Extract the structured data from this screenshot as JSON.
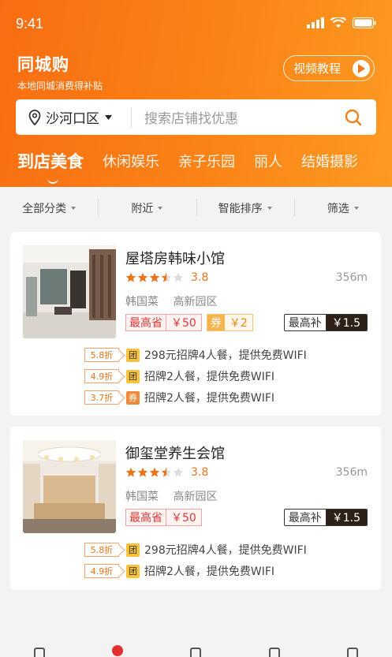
{
  "status_bar": {
    "time": "9:41"
  },
  "brand": {
    "title": "同城购",
    "subtitle": "本地同城消费得补贴"
  },
  "video_tutorial": {
    "label": "视频教程"
  },
  "search": {
    "location": "沙河口区",
    "placeholder": "搜索店铺找优惠"
  },
  "category_tabs": [
    {
      "label": "到店美食",
      "active": true
    },
    {
      "label": "休闲娱乐"
    },
    {
      "label": "亲子乐园"
    },
    {
      "label": "丽人"
    },
    {
      "label": "结婚摄影"
    }
  ],
  "filters": [
    {
      "label": "全部分类"
    },
    {
      "label": "附近"
    },
    {
      "label": "智能排序"
    },
    {
      "label": "筛选"
    }
  ],
  "shops": [
    {
      "name": "屋塔房韩味小馆",
      "rating": "3.8",
      "stars": 3.5,
      "distance": "356m",
      "tags": [
        "韩国菜",
        "高新园区"
      ],
      "badges": [
        {
          "label": "最高省",
          "value": "￥50",
          "kind": "save"
        },
        {
          "label": "券",
          "value": "￥2",
          "kind": "coupon"
        }
      ],
      "subsidy": {
        "label": "最高补",
        "value": "￥1.5"
      },
      "deals": [
        {
          "discount": "5.8折",
          "type": "团",
          "text": "298元招牌4人餐，提供免费WIFI"
        },
        {
          "discount": "4.9折",
          "type": "团",
          "text": "招牌2人餐，提供免费WIFI"
        },
        {
          "discount": "3.7折",
          "type": "券",
          "text": "招牌2人餐，提供免费WIFI"
        }
      ]
    },
    {
      "name": "御玺堂养生会馆",
      "rating": "3.8",
      "stars": 3.5,
      "distance": "356m",
      "tags": [
        "韩国菜",
        "高新园区"
      ],
      "badges": [
        {
          "label": "最高省",
          "value": "￥50",
          "kind": "save"
        }
      ],
      "subsidy": {
        "label": "最高补",
        "value": "￥1.5"
      },
      "deals": [
        {
          "discount": "5.8折",
          "type": "团",
          "text": "298元招牌4人餐，提供免费WIFI"
        },
        {
          "discount": "4.9折",
          "type": "团",
          "text": "招牌2人餐，提供免费WIFI"
        }
      ]
    }
  ],
  "colors": {
    "brand_orange": "#fb7a16",
    "save_red": "#e03636",
    "star": "#e8741c"
  }
}
